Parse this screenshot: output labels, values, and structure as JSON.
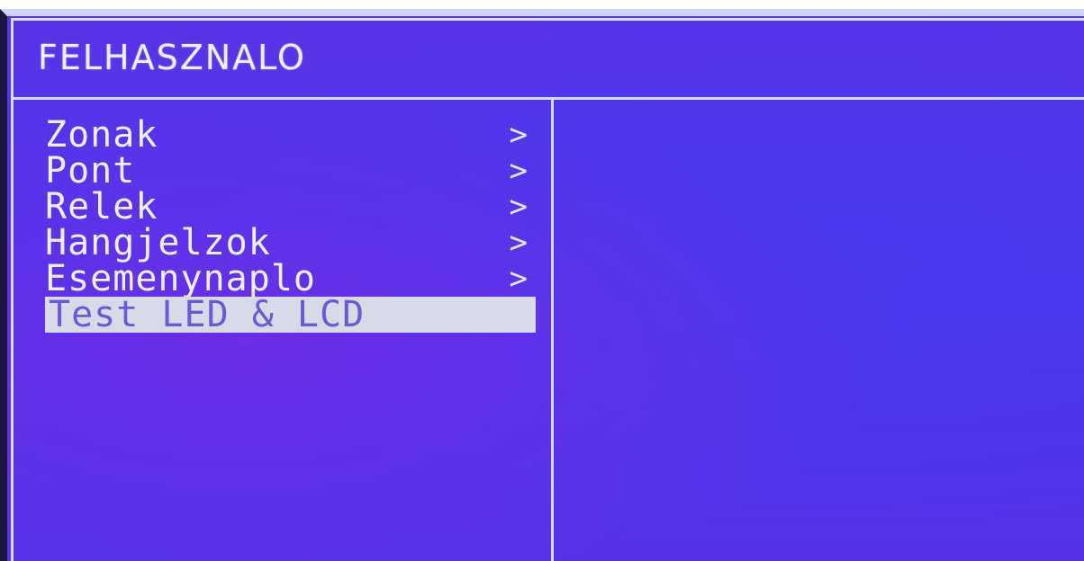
{
  "header": {
    "title": "FELHASZNALO"
  },
  "menu": {
    "items": [
      {
        "label": "Zonak",
        "arrow": ">"
      },
      {
        "label": "Pont",
        "arrow": ">"
      },
      {
        "label": "Relek",
        "arrow": ">"
      },
      {
        "label": "Hangjelzok",
        "arrow": ">"
      },
      {
        "label": "Esemenynaplo",
        "arrow": ">"
      },
      {
        "label": "Test LED & LCD",
        "selected": true
      }
    ]
  },
  "colors": {
    "screen_bg": "#4c36ef",
    "text": "#eef0ff",
    "selection_bg": "#d8dae8",
    "border": "#d8dcff"
  }
}
